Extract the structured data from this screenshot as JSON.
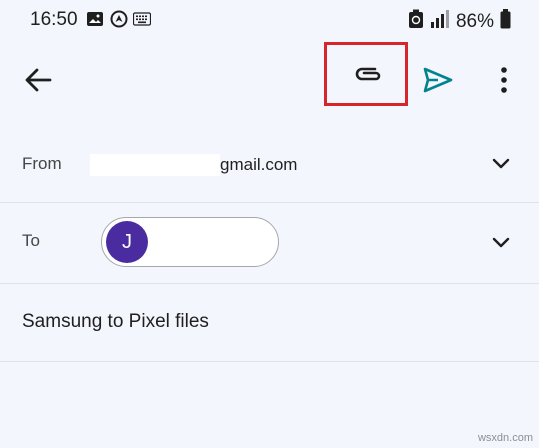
{
  "status_bar": {
    "time": "16:50",
    "battery": "86%",
    "left_icons": [
      "image-icon",
      "location-icon",
      "keyboard-icon"
    ],
    "right_icons": [
      "recycle-icon",
      "signal-icon",
      "battery-icon"
    ]
  },
  "appbar": {
    "icons": [
      "back-arrow-icon",
      "paperclip-icon",
      "send-icon",
      "more-vert-icon"
    ],
    "highlight_color": "#d7262b",
    "send_color": "#00838f"
  },
  "compose": {
    "from_label": "From",
    "from_value_suffix": "gmail.com",
    "to_label": "To",
    "to_chip_initial": "J",
    "to_chip_avatar_color": "#4a2ca0",
    "subject": "Samsung to Pixel files"
  },
  "watermark": "wsxdn.com"
}
